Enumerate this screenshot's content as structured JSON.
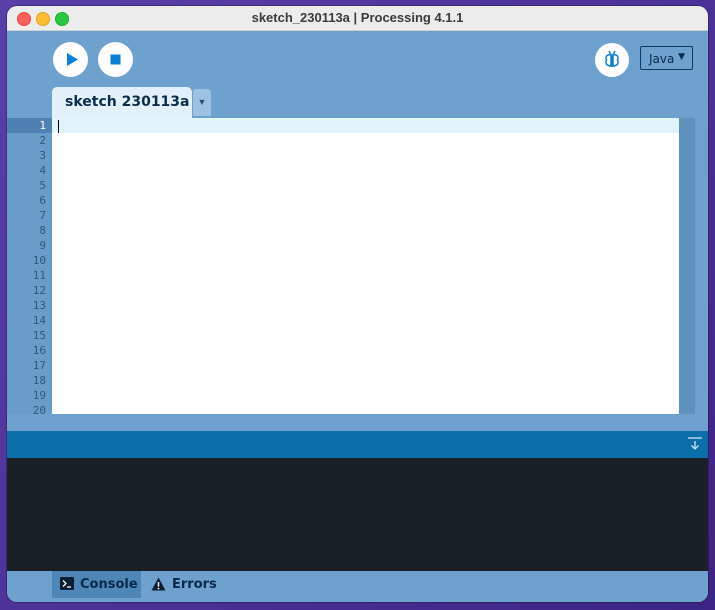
{
  "window": {
    "title": "sketch_230113a | Processing 4.1.1"
  },
  "toolbar": {
    "run_icon": "play-icon",
    "stop_icon": "stop-icon",
    "debug_icon": "butterfly-debug-icon",
    "mode_selected": "Java",
    "mode_arrow": "▼"
  },
  "tabs": [
    {
      "label": "sketch 230113a"
    }
  ],
  "tab_menu_arrow": "▼",
  "editor": {
    "line_numbers": [
      "1",
      "2",
      "3",
      "4",
      "5",
      "6",
      "7",
      "8",
      "9",
      "10",
      "11",
      "12",
      "13",
      "14",
      "15",
      "16",
      "17",
      "18",
      "19",
      "20"
    ],
    "current_line": 1,
    "content": ""
  },
  "console": {
    "output": ""
  },
  "footer": {
    "tabs": [
      {
        "label": "Console",
        "icon": "terminal-icon"
      },
      {
        "label": "Errors",
        "icon": "warning-icon"
      }
    ]
  },
  "colors": {
    "chrome": "#6ea1ce",
    "console_header": "#0a6ea8",
    "console_bg": "#1b2026",
    "run_blue": "#0a7fd6"
  }
}
